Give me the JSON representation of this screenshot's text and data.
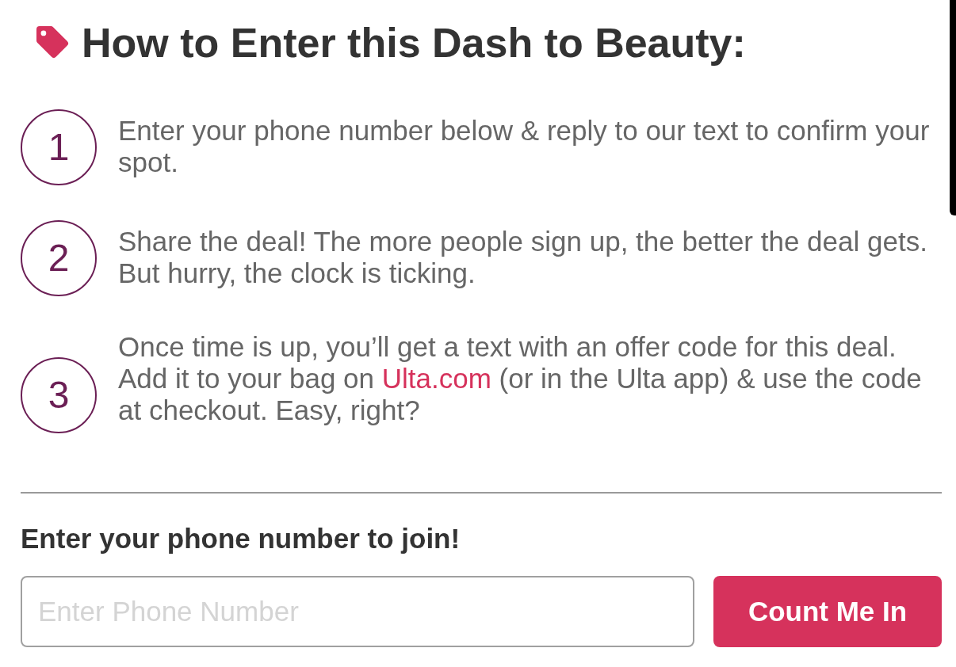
{
  "header": {
    "title": "How to Enter this Dash to Beauty:"
  },
  "steps": [
    {
      "number": "1",
      "segments": [
        {
          "kind": "text",
          "text": "Enter your phone number below & reply to our text to confirm your spot."
        }
      ]
    },
    {
      "number": "2",
      "segments": [
        {
          "kind": "text",
          "text": "Share the deal! The more people sign up, the better the deal gets. But hurry, the clock is ticking."
        }
      ]
    },
    {
      "number": "3",
      "segments": [
        {
          "kind": "text",
          "text": "Once time is up, you’ll get a text with an offer code for this deal. Add it to your bag on "
        },
        {
          "kind": "link",
          "text": "Ulta.com"
        },
        {
          "kind": "text",
          "text": " (or in the Ulta app) & use the code at checkout. Easy, right?"
        }
      ]
    }
  ],
  "signup": {
    "label": "Enter your phone number to join!",
    "phone_field": {
      "placeholder": "Enter Phone Number"
    },
    "button": "Count Me In"
  }
}
